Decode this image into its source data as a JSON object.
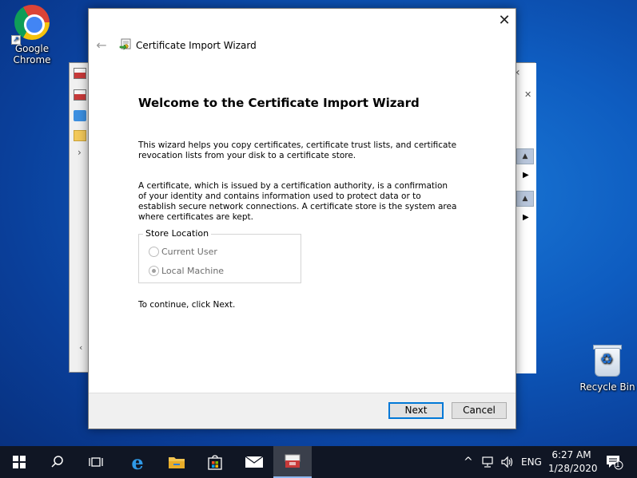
{
  "desktop": {
    "icons": [
      {
        "label": "Google Chrome",
        "icon": "chrome-icon"
      },
      {
        "label": "Recycle Bin",
        "icon": "recycle-bin-icon"
      }
    ]
  },
  "background_window": {
    "icon": "mmc-console-icon"
  },
  "wizard": {
    "title": "Certificate Import Wizard",
    "close_glyph": "✕",
    "back_glyph": "←",
    "heading": "Welcome to the Certificate Import Wizard",
    "paragraph1": "This wizard helps you copy certificates, certificate trust lists, and certificate revocation lists from your disk to a certificate store.",
    "paragraph2": "A certificate, which is issued by a certification authority, is a confirmation of your identity and contains information used to protect data or to establish secure network connections. A certificate store is the system area where certificates are kept.",
    "store_location": {
      "legend": "Store Location",
      "options": [
        {
          "label": "Current User",
          "checked": false,
          "enabled": false
        },
        {
          "label": "Local Machine",
          "checked": true,
          "enabled": false
        }
      ]
    },
    "continue_text": "To continue, click Next.",
    "buttons": {
      "next": "Next",
      "cancel": "Cancel"
    }
  },
  "taskbar": {
    "language": "ENG",
    "time": "6:27 AM",
    "date": "1/28/2020",
    "notification_count": "1",
    "accent_color": "#0078d7"
  }
}
